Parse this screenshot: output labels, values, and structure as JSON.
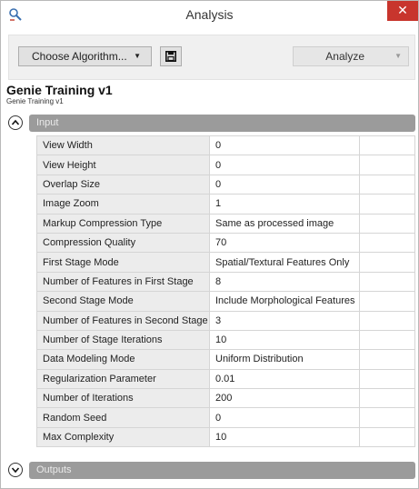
{
  "window": {
    "title": "Analysis",
    "close_glyph": "✕",
    "icon": "analysis-app-icon"
  },
  "toolbar": {
    "choose_label": "Choose Algorithm...",
    "choose_caret": "▼",
    "save_icon": "save-icon",
    "analyze_label": "Analyze",
    "analyze_caret": "▼"
  },
  "algorithm": {
    "title": "Genie Training v1",
    "subtitle": "Genie Training v1"
  },
  "sections": {
    "input": {
      "label": "Input",
      "expanded": true
    },
    "outputs": {
      "label": "Outputs",
      "expanded": false
    }
  },
  "parameters": [
    {
      "name": "View Width",
      "value": "0"
    },
    {
      "name": "View Height",
      "value": "0"
    },
    {
      "name": "Overlap Size",
      "value": "0"
    },
    {
      "name": "Image Zoom",
      "value": "1"
    },
    {
      "name": "Markup Compression Type",
      "value": "Same as processed image"
    },
    {
      "name": "Compression Quality",
      "value": "70"
    },
    {
      "name": "First Stage Mode",
      "value": "Spatial/Textural Features Only"
    },
    {
      "name": "Number of Features in First Stage",
      "value": "8"
    },
    {
      "name": "Second Stage Mode",
      "value": "Include Morphological Features"
    },
    {
      "name": "Number of Features in Second Stage",
      "value": "3"
    },
    {
      "name": "Number of Stage Iterations",
      "value": "10"
    },
    {
      "name": "Data Modeling Mode",
      "value": "Uniform Distribution"
    },
    {
      "name": "Regularization Parameter",
      "value": "0.01"
    },
    {
      "name": "Number of Iterations",
      "value": "200"
    },
    {
      "name": "Random Seed",
      "value": "0"
    },
    {
      "name": "Max Complexity",
      "value": "10"
    }
  ],
  "colors": {
    "section_header": "#9b9b9b",
    "close_button": "#c8352d",
    "name_cell": "#ececec"
  }
}
